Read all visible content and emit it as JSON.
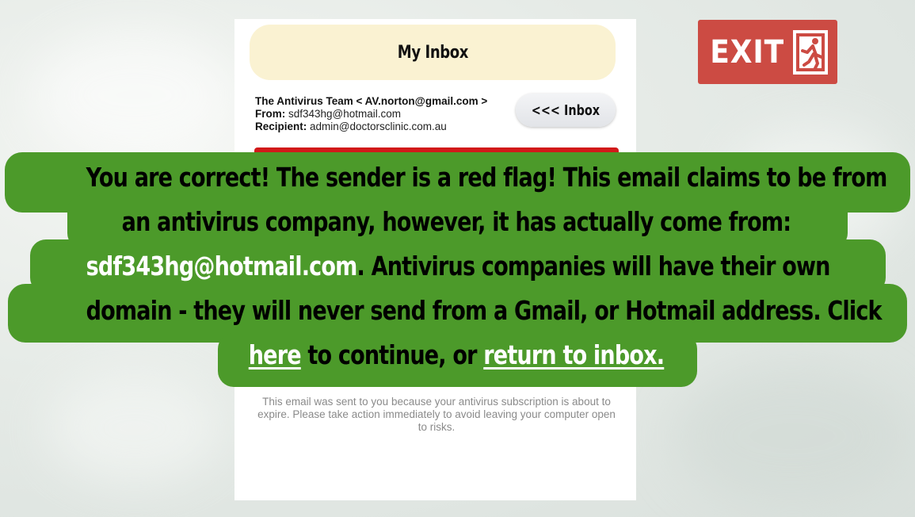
{
  "inbox": {
    "title": "My Inbox",
    "back_label": "<<< Inbox"
  },
  "email": {
    "sender": "The Antivirus Team < AV.norton@gmail.com >",
    "from_label": "From:",
    "from_value": " sdf343hg@hotmail.com",
    "recipient_label": "Recipient:",
    "recipient_value": " admin@doctorsclinic.com.au",
    "footer_note": "This email was sent to you because your antivirus subscription is about to expire. Please take action immediately to avoid leaving your computer open to risks."
  },
  "exit": {
    "label": "EXIT",
    "icon": "emergency-exit-icon"
  },
  "feedback": {
    "line1": "You are correct! The sender is a red flag! This email claims to be from",
    "line2": "an antivirus company, however, it has actually come from:",
    "line3_highlight": "sdf343hg@hotmail.com",
    "line3_rest": ". Antivirus companies will have their own",
    "line4": "domain - they will never send from a Gmail, or Hotmail address. Click",
    "line5_link1": "here",
    "line5_mid": " to continue, or ",
    "line5_link2": "return to inbox."
  },
  "colors": {
    "feedback_green": "#4c9a2a",
    "exit_red": "#cc4b43",
    "inbox_header": "#faf2d2",
    "alert_red": "#d11a1a"
  }
}
